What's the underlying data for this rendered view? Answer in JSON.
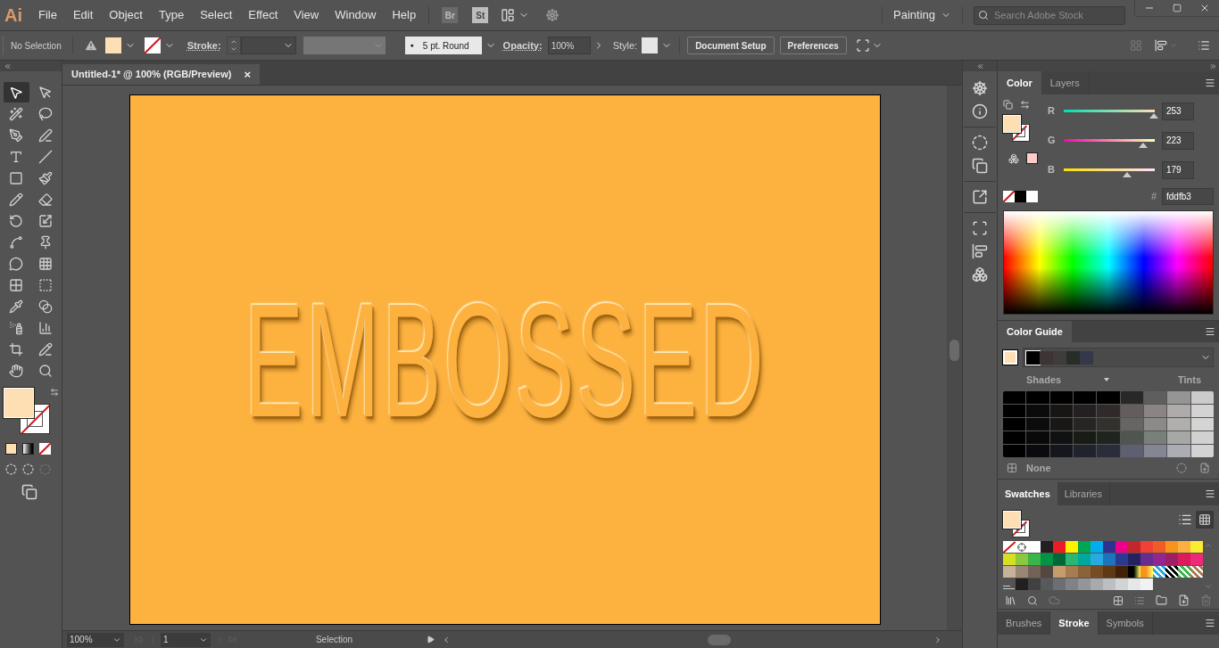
{
  "app": {
    "logo": "Ai",
    "menu": [
      "File",
      "Edit",
      "Object",
      "Type",
      "Select",
      "Effect",
      "View",
      "Window",
      "Help"
    ],
    "bridge": "Br",
    "stock": "St",
    "workspace": "Painting",
    "search": {
      "placeholder": "Search Adobe Stock"
    }
  },
  "control_bar": {
    "selection": "No Selection",
    "stroke_label": "Stroke:",
    "brush": "5 pt. Round",
    "brush_dot": "●",
    "opacity_label": "Opacity:",
    "opacity": "100%",
    "style_label": "Style:",
    "buttons": [
      "Document Setup",
      "Preferences"
    ]
  },
  "document_tab": {
    "title": "Untitled-1* @ 100% (RGB/Preview)",
    "close": "×"
  },
  "tools": [
    {
      "selected": true
    },
    {
      "selected": false
    },
    {
      "selected": false
    },
    {
      "selected": false
    },
    {
      "selected": false
    },
    {
      "selected": false
    },
    {
      "selected": false
    },
    {
      "selected": false
    },
    {
      "selected": false
    },
    {
      "selected": false
    },
    {
      "selected": false
    },
    {
      "selected": false
    },
    {
      "selected": false
    },
    {
      "selected": false
    },
    {
      "selected": false
    },
    {
      "selected": false
    },
    {
      "selected": false
    },
    {
      "selected": false
    },
    {
      "selected": false
    },
    {
      "selected": false
    },
    {
      "selected": false
    },
    {
      "selected": false
    },
    {
      "selected": false
    },
    {
      "selected": false
    },
    {
      "selected": false
    },
    {
      "selected": false
    },
    {
      "selected": false
    },
    {
      "selected": false
    }
  ],
  "artboard": {
    "color": "#fdb240",
    "text": "EMBOSSED"
  },
  "color_panel": {
    "tabs": [
      {
        "label": "Color",
        "selected": true
      },
      {
        "label": "Layers",
        "selected": false
      }
    ],
    "sliders": [
      {
        "label": "R",
        "value": "253",
        "level": 0.99
      },
      {
        "label": "G",
        "value": "223",
        "level": 0.87
      },
      {
        "label": "B",
        "value": "179",
        "level": 0.7
      }
    ],
    "hex_label": "#",
    "hex": "fddfb3"
  },
  "color_guide": {
    "tab": "Color Guide",
    "harmony": [
      {
        "color": "#000000"
      },
      {
        "color": "#3d3535"
      },
      {
        "color": "#3f3d3a"
      },
      {
        "color": "#262e27"
      },
      {
        "color": "#36384a"
      }
    ],
    "shades_label": "Shades",
    "tints_label": "Tints",
    "footer": "None"
  },
  "swatches_panel": {
    "tabs": [
      {
        "label": "Swatches",
        "selected": true
      },
      {
        "label": "Libraries",
        "selected": false
      }
    ],
    "swatches": [
      {
        "kind": "none"
      },
      {
        "kind": "registration"
      },
      {
        "kind": "color",
        "color": "#ffffff"
      },
      {
        "kind": "color",
        "color": "#231f20"
      },
      {
        "kind": "color",
        "color": "#ed1c24"
      },
      {
        "kind": "color",
        "color": "#fff200"
      },
      {
        "kind": "color",
        "color": "#00a651"
      },
      {
        "kind": "color",
        "color": "#00aeef"
      },
      {
        "kind": "color",
        "color": "#2e3192"
      },
      {
        "kind": "color",
        "color": "#ec008c"
      },
      {
        "kind": "color",
        "color": "#c1272d"
      },
      {
        "kind": "color",
        "color": "#ef4136"
      },
      {
        "kind": "color",
        "color": "#f15a29"
      },
      {
        "kind": "color",
        "color": "#f7941d"
      },
      {
        "kind": "color",
        "color": "#fbb040"
      },
      {
        "kind": "color",
        "color": "#f9ed32"
      },
      {
        "kind": "color",
        "color": "#d7df23"
      },
      {
        "kind": "color",
        "color": "#8dc63f"
      },
      {
        "kind": "color",
        "color": "#39b54a"
      },
      {
        "kind": "color",
        "color": "#009444"
      },
      {
        "kind": "color",
        "color": "#006838"
      },
      {
        "kind": "color",
        "color": "#2bb673"
      },
      {
        "kind": "color",
        "color": "#00a79d"
      },
      {
        "kind": "color",
        "color": "#27aae1"
      },
      {
        "kind": "color",
        "color": "#1c75bc"
      },
      {
        "kind": "color",
        "color": "#2b3990"
      },
      {
        "kind": "color",
        "color": "#262262"
      },
      {
        "kind": "color",
        "color": "#662d91"
      },
      {
        "kind": "color",
        "color": "#92278f"
      },
      {
        "kind": "color",
        "color": "#9e1f63"
      },
      {
        "kind": "color",
        "color": "#da1c5c"
      },
      {
        "kind": "color",
        "color": "#ee2a7b"
      },
      {
        "kind": "color",
        "color": "#c7b299"
      },
      {
        "kind": "color",
        "color": "#998675"
      },
      {
        "kind": "color",
        "color": "#736357"
      },
      {
        "kind": "color",
        "color": "#534741"
      },
      {
        "kind": "color",
        "color": "#c69c6d"
      },
      {
        "kind": "color",
        "color": "#a67c52"
      },
      {
        "kind": "color",
        "color": "#8c6239"
      },
      {
        "kind": "color",
        "color": "#754c24"
      },
      {
        "kind": "color",
        "color": "#603813"
      },
      {
        "kind": "color",
        "color": "#42210b"
      },
      {
        "kind": "gradient",
        "color": "#000000"
      },
      {
        "kind": "gradient",
        "color": "#f7941d"
      },
      {
        "kind": "pattern",
        "color": "#27aae1"
      },
      {
        "kind": "pattern",
        "color": "#000000"
      },
      {
        "kind": "pattern",
        "color": "#39b54a"
      },
      {
        "kind": "pattern",
        "color": "#a67c52"
      },
      {
        "kind": "group"
      },
      {
        "kind": "color",
        "color": "#231f20"
      },
      {
        "kind": "color",
        "color": "#414042"
      },
      {
        "kind": "color",
        "color": "#58595b"
      },
      {
        "kind": "color",
        "color": "#6d6e71"
      },
      {
        "kind": "color",
        "color": "#808285"
      },
      {
        "kind": "color",
        "color": "#939598"
      },
      {
        "kind": "color",
        "color": "#a7a9ac"
      },
      {
        "kind": "color",
        "color": "#bcbec0"
      },
      {
        "kind": "color",
        "color": "#d1d3d4"
      },
      {
        "kind": "color",
        "color": "#e6e7e8"
      },
      {
        "kind": "color",
        "color": "#f1f2f2"
      }
    ]
  },
  "bottom_tabs": [
    {
      "label": "Brushes",
      "selected": false
    },
    {
      "label": "Stroke",
      "selected": true
    },
    {
      "label": "Symbols",
      "selected": false
    }
  ],
  "status_bar": {
    "zoom": "100%",
    "artboard": "1",
    "tool": "Selection"
  }
}
